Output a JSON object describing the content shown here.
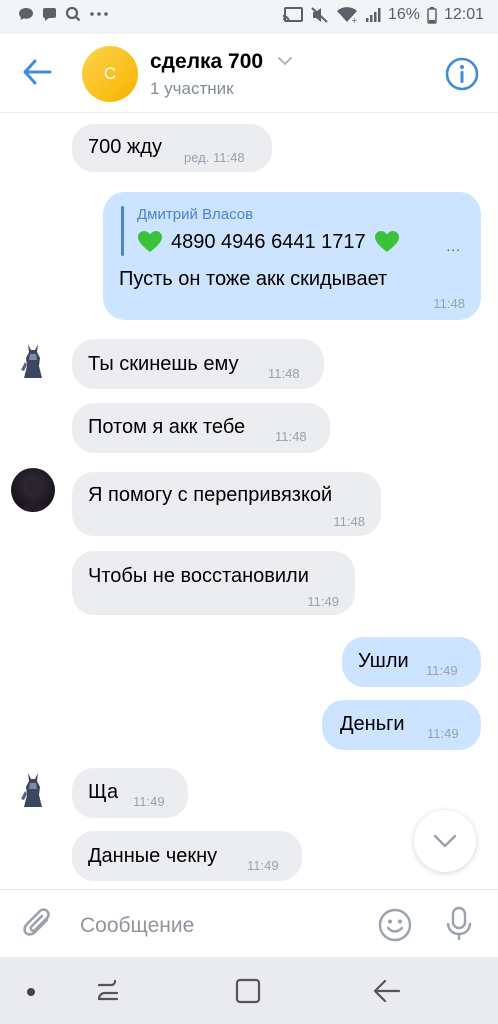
{
  "status_bar": {
    "battery": "16%",
    "time": "12:01",
    "left_icons": [
      "chat-bubble-icon",
      "message-icon",
      "search-icon",
      "more-icon"
    ],
    "right_icons": [
      "cast-icon",
      "mute-icon",
      "wifi-icon",
      "signal-icon",
      "battery-icon"
    ]
  },
  "header": {
    "avatar_letter": "С",
    "avatar_color": "#f7c325",
    "title": "сделка 700",
    "subtitle": "1 участник",
    "accent": "#3f8ae0"
  },
  "messages": [
    {
      "text": "700 жду",
      "time": "ред. 11:48",
      "direction": "in"
    },
    {
      "reply_author": "Дмитрий Власов",
      "reply_text": "4890 4946 6441 1717",
      "reply_more": "...",
      "text": "Пусть он тоже акк скидывает",
      "time": "11:48",
      "direction": "out"
    },
    {
      "text": "Ты скинешь ему",
      "time": "11:48",
      "direction": "in"
    },
    {
      "text": "Потом я акк тебе",
      "time": "11:48",
      "direction": "in"
    },
    {
      "text": "Я помогу с перепривязкой",
      "time": "11:48",
      "direction": "in"
    },
    {
      "text": "Чтобы не восстановили",
      "time": "11:49",
      "direction": "in"
    },
    {
      "text": "Ушли",
      "time": "11:49",
      "direction": "out"
    },
    {
      "text": "Деньги",
      "time": "11:49",
      "direction": "out"
    },
    {
      "text": "Ща",
      "time": "11:49",
      "direction": "in"
    },
    {
      "text": "Данные чекну",
      "time": "11:49",
      "direction": "in"
    }
  ],
  "composer": {
    "placeholder": "Сообщение"
  },
  "colors": {
    "incoming_bubble": "#ebedf0",
    "outgoing_bubble": "#cce4ff",
    "time_text": "#99a2ad",
    "reply_author": "#4a86cf",
    "heart": "#3cc13b"
  }
}
